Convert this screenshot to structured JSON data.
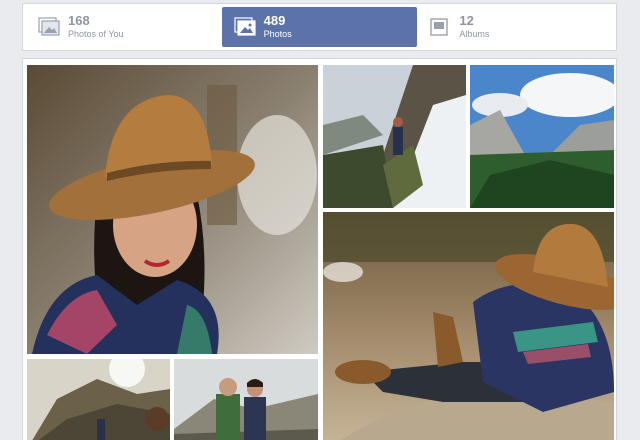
{
  "tabs": [
    {
      "count": "168",
      "label": "Photos of You",
      "icon": "tagged-photos-icon",
      "active": false
    },
    {
      "count": "489",
      "label": "Photos",
      "icon": "photos-icon",
      "active": true
    },
    {
      "count": "12",
      "label": "Albums",
      "icon": "albums-icon",
      "active": false
    }
  ],
  "colors": {
    "active_tab": "#5b73a8",
    "inactive_text": "#8f96a3",
    "background": "#e9ebee"
  }
}
